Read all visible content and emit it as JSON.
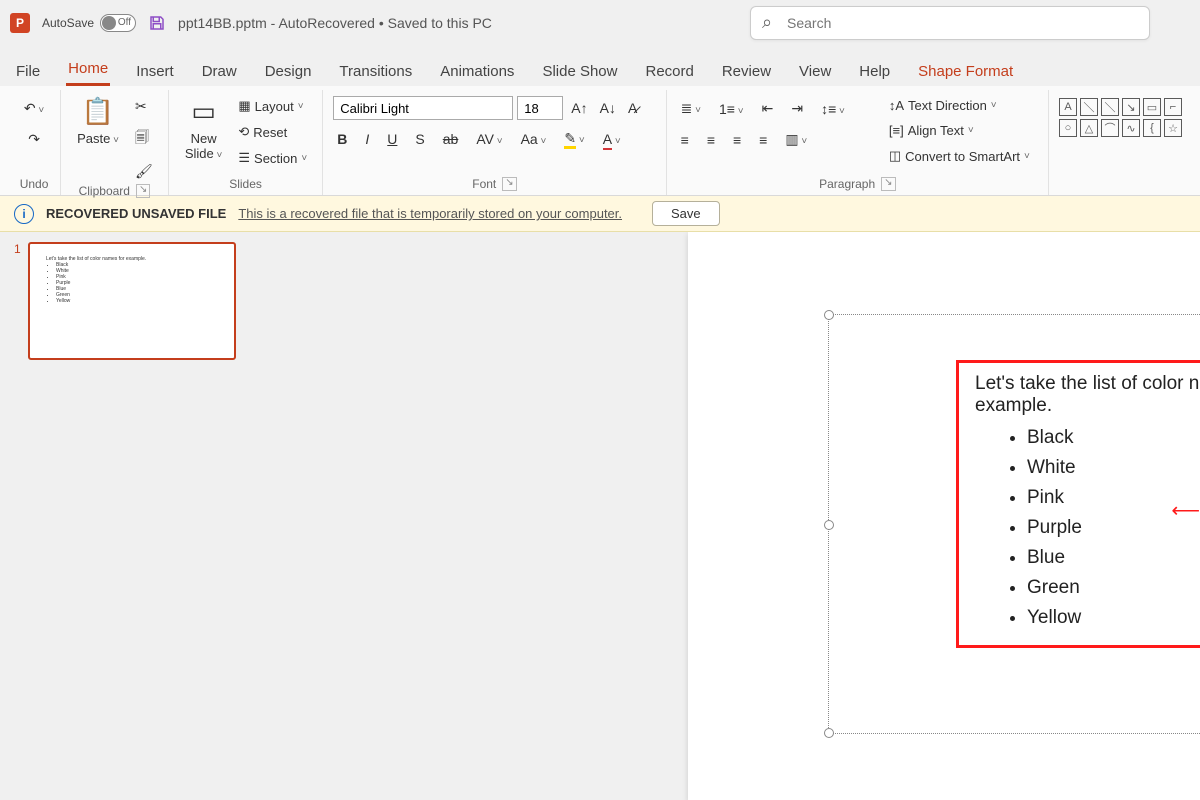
{
  "titlebar": {
    "autosave_label": "AutoSave",
    "autosave_state": "Off",
    "filename": "ppt14BB.pptm",
    "status": " -  AutoRecovered • Saved to this PC",
    "search_placeholder": "Search"
  },
  "tabs": {
    "file": "File",
    "home": "Home",
    "insert": "Insert",
    "draw": "Draw",
    "design": "Design",
    "transitions": "Transitions",
    "animations": "Animations",
    "slideshow": "Slide Show",
    "record": "Record",
    "review": "Review",
    "view": "View",
    "help": "Help",
    "shapeformat": "Shape Format"
  },
  "ribbon": {
    "undo_label": "Undo",
    "clipboard_label": "Clipboard",
    "paste": "Paste",
    "slides_label": "Slides",
    "newslide": "New\nSlide",
    "layout": "Layout",
    "reset": "Reset",
    "section": "Section",
    "font_label": "Font",
    "font_name": "Calibri Light",
    "font_size": "18",
    "paragraph_label": "Paragraph",
    "textdir": "Text Direction",
    "align": "Align Text",
    "smartart": "Convert to SmartArt"
  },
  "messagebar": {
    "title": "RECOVERED UNSAVED FILE",
    "text": "This is a recovered file that is temporarily stored on your computer.",
    "button": "Save"
  },
  "thumbs": {
    "n1": "1"
  },
  "content": {
    "intro": "Let's take the list of color names for example.",
    "items": [
      "Black",
      "White",
      "Pink",
      "Purple",
      "Blue",
      "Green",
      "Yellow"
    ]
  }
}
